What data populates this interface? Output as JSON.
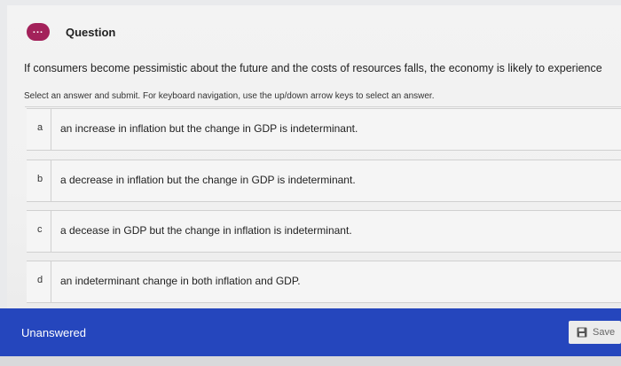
{
  "question": {
    "title": "Question",
    "icon": "ellipsis-icon",
    "dots": "...",
    "text": "If consumers become pessimistic about the future and the costs of resources falls, the economy is likely to experience",
    "instructions": "Select an answer and submit. For keyboard navigation, use the up/down arrow keys to select an answer."
  },
  "options": [
    {
      "letter": "a",
      "text": "an increase in inflation but the change in GDP is indeterminant."
    },
    {
      "letter": "b",
      "text": "a decrease in inflation but the change in GDP is indeterminant."
    },
    {
      "letter": "c",
      "text": "a decease in GDP but the change in inflation is indeterminant."
    },
    {
      "letter": "d",
      "text": "an indeterminant change in both inflation and GDP."
    }
  ],
  "footer": {
    "status": "Unanswered",
    "save_label": "Save",
    "save_icon": "floppy-disk-icon"
  },
  "colors": {
    "question_icon": "#a3215a",
    "footer_bar": "#2546bd",
    "background": "#e9eaec"
  }
}
